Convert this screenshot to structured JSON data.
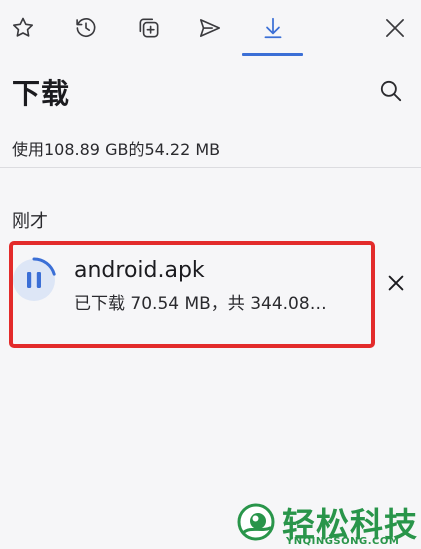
{
  "toolbar": {
    "tabs": [
      {
        "icon": "star-icon"
      },
      {
        "icon": "history-icon"
      },
      {
        "icon": "collections-icon"
      },
      {
        "icon": "share-icon"
      },
      {
        "icon": "download-icon",
        "active": true
      }
    ],
    "close_icon": "close-icon"
  },
  "header": {
    "title": "下载",
    "search_icon": "search-icon"
  },
  "storage": {
    "text": "使用108.89 GB的54.22 MB"
  },
  "downloads": {
    "section_label": "刚才",
    "items": [
      {
        "name": "android.apk",
        "status": "已下载 70.54 MB，共 344.08…",
        "progress": 0.205,
        "state": "paused"
      }
    ]
  },
  "watermark": {
    "text": "轻松科技",
    "url": "YNQINGSONG.COM"
  },
  "colors": {
    "accent": "#3b6fd6",
    "highlight": "#e32b2b",
    "background": "#f6f6f8",
    "watermark": "#29954a"
  }
}
